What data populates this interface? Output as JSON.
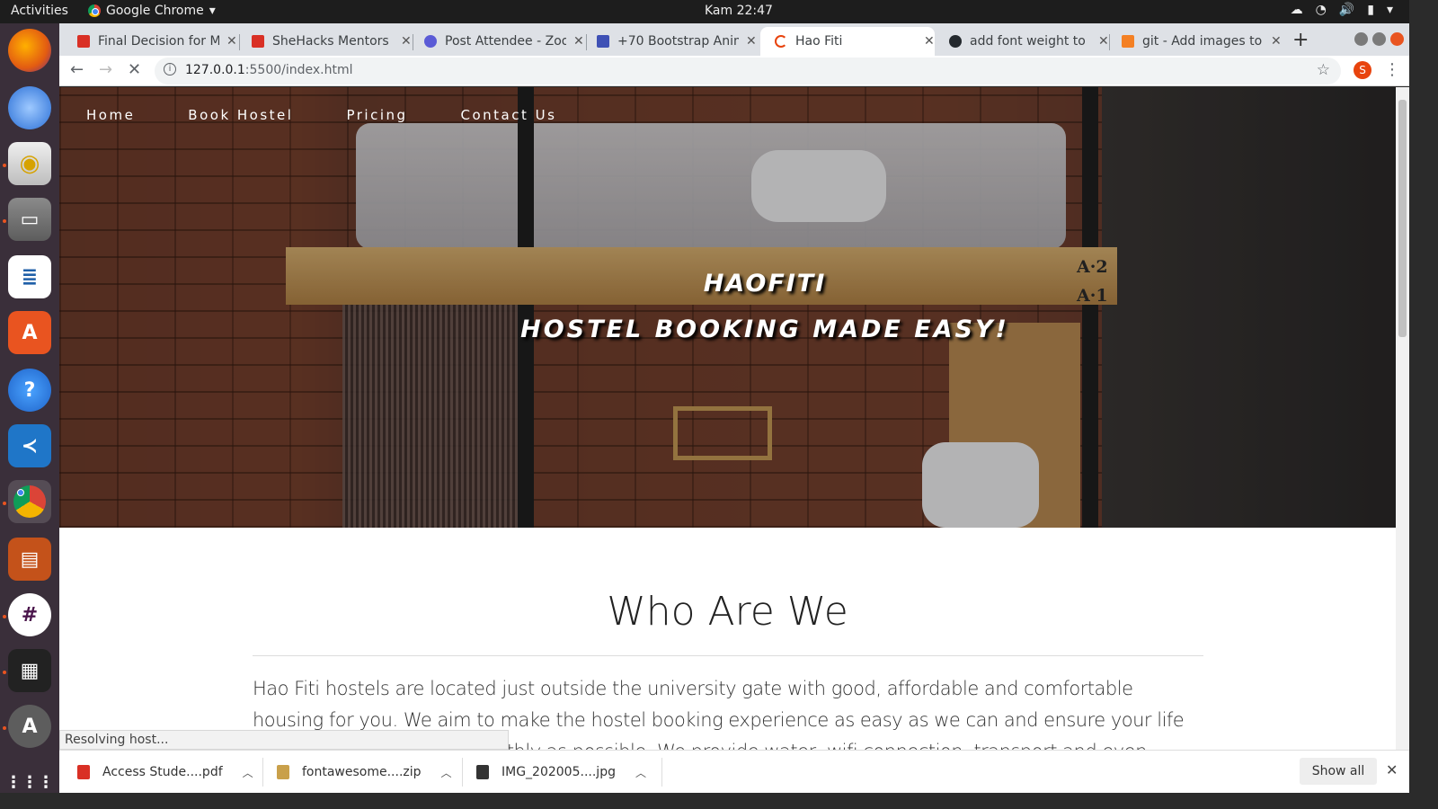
{
  "desktop": {
    "activities": "Activities",
    "app_name": "Google Chrome",
    "clock": "Kam 22:47"
  },
  "dock": {
    "items": [
      "firefox",
      "thunderbird",
      "rhythmbox",
      "files",
      "libreoffice-writer",
      "ubuntu-software",
      "help",
      "vscode",
      "chrome",
      "libreoffice-impress",
      "slack",
      "clapper",
      "software-updater",
      "show-apps"
    ]
  },
  "browser": {
    "tabs": [
      {
        "label": "Final Decision for M",
        "icon": "gmail-icon",
        "color": "#d93025"
      },
      {
        "label": "SheHacks Mentors",
        "icon": "gmail-icon",
        "color": "#d93025"
      },
      {
        "label": "Post Attendee - Zoo",
        "icon": "zoom-icon",
        "color": "#5b5bd6"
      },
      {
        "label": "+70 Bootstrap Anim",
        "icon": "mdb-icon",
        "color": "#3f51b5"
      },
      {
        "label": "Hao Fiti",
        "icon": "loading-icon",
        "color": "#e8430d"
      },
      {
        "label": "add font weight to",
        "icon": "github-icon",
        "color": "#24292e"
      },
      {
        "label": "git - Add images to",
        "icon": "stackoverflow-icon",
        "color": "#f48024"
      }
    ],
    "url_host": "127.0.0.1",
    "url_path": ":5500/index.html",
    "profile_initial": "S",
    "status": "Resolving host..."
  },
  "page": {
    "nav": [
      "Home",
      "Book Hostel",
      "Pricing",
      "Contact Us"
    ],
    "hero_title": "HAOFITI",
    "hero_subtitle": "HOSTEL BOOKING MADE EASY!",
    "bunk_labels": [
      "A·2",
      "A·1"
    ],
    "section_title": "Who Are We",
    "about_text": "Hao Fiti hostels are located just outside the university gate with good, affordable and comfortable housing for you. We aim to make the hostel booking experience as easy as we can and ensure your life in school continues as smoothly as possible. We provide water, wifi connection, transport and even laundry services! We offer a spacious"
  },
  "downloads": {
    "items": [
      {
        "label": "Access Stude....pdf",
        "color": "#d93025"
      },
      {
        "label": "fontawesome....zip",
        "color": "#c9a04a"
      },
      {
        "label": "IMG_202005....jpg",
        "color": "#333333"
      }
    ],
    "show_all": "Show all"
  }
}
